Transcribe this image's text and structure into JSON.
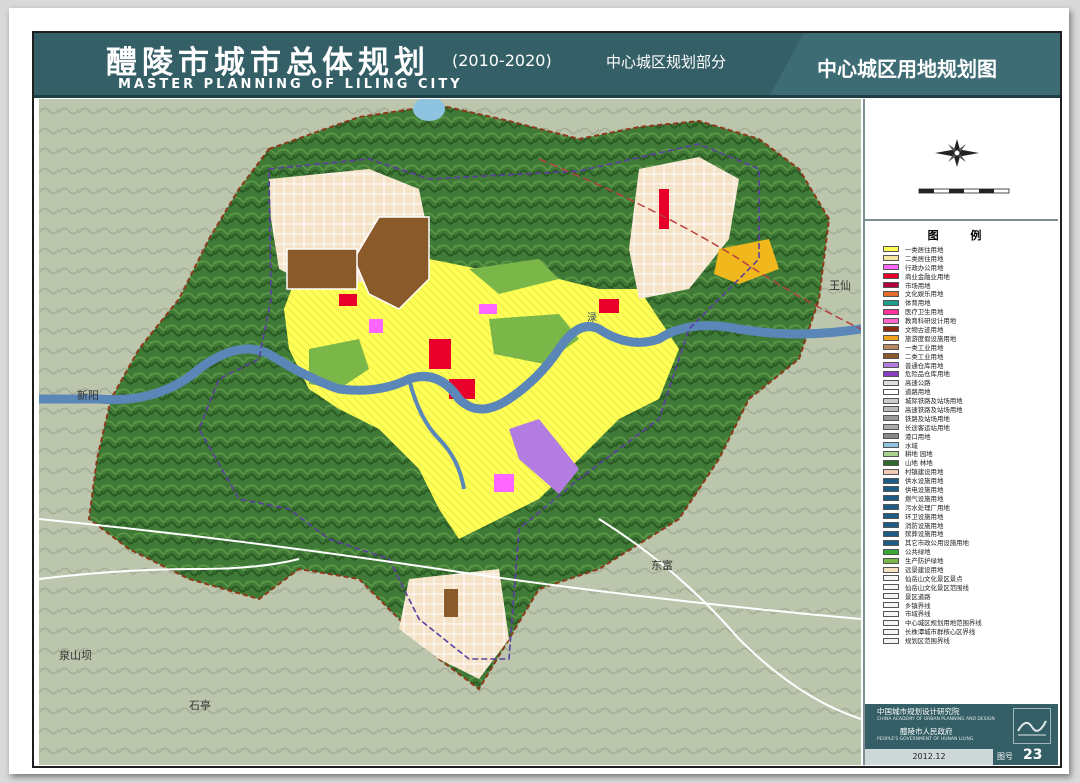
{
  "header": {
    "title_cn": "醴陵市城市总体规划",
    "years": "(2010-2020)",
    "part": "中心城区规划部分",
    "title_en": "MASTER PLANNING OF LILING CITY",
    "map_title": "中心城区用地规划图"
  },
  "legend": {
    "title": "图 例",
    "items": [
      {
        "label": "一类居住用地",
        "color": "#ffff55"
      },
      {
        "label": "二类居住用地",
        "color": "#f5e79e"
      },
      {
        "label": "行政办公用地",
        "color": "#ff66ff"
      },
      {
        "label": "商业金融业用地",
        "color": "#e8002a"
      },
      {
        "label": "市场用地",
        "color": "#b4003a"
      },
      {
        "label": "文化娱乐用地",
        "color": "#e56b2c"
      },
      {
        "label": "体育用地",
        "color": "#1f9e8e"
      },
      {
        "label": "医疗卫生用地",
        "color": "#ff3399"
      },
      {
        "label": "教育科研设计用地",
        "color": "#ff66cc"
      },
      {
        "label": "文物古迹用地",
        "color": "#8b2a0e"
      },
      {
        "label": "旅游度假设施用地",
        "color": "#f0a21c"
      },
      {
        "label": "一类工业用地",
        "color": "#b88a5f"
      },
      {
        "label": "二类工业用地",
        "color": "#8b5a2b"
      },
      {
        "label": "普通仓库用地",
        "color": "#b27ce0"
      },
      {
        "label": "危险品仓库用地",
        "color": "#8a3fc2"
      },
      {
        "label": "高速公路",
        "color": "#dddddd"
      },
      {
        "label": "道路用地",
        "color": "#ffffff"
      },
      {
        "label": "城际铁路及站场用地",
        "color": "#cccccc"
      },
      {
        "label": "高速铁路及站场用地",
        "color": "#bbbbbb"
      },
      {
        "label": "铁路及站场用地",
        "color": "#999999"
      },
      {
        "label": "长途客运站用地",
        "color": "#aaaaaa"
      },
      {
        "label": "港口用地",
        "color": "#888888"
      },
      {
        "label": "水域",
        "color": "#8ec4e0"
      },
      {
        "label": "耕地 园地",
        "color": "#a9d18e"
      },
      {
        "label": "山地 林地",
        "color": "#2e6b2b"
      },
      {
        "label": "村镇建设用地",
        "color": "#f2c9b5"
      },
      {
        "label": "供水设施用地",
        "color": "#1c5c85"
      },
      {
        "label": "供电设施用地",
        "color": "#1c5c85"
      },
      {
        "label": "燃气设施用地",
        "color": "#1c5c85"
      },
      {
        "label": "污水处理厂用地",
        "color": "#1c5c85"
      },
      {
        "label": "环卫设施用地",
        "color": "#1c5c85"
      },
      {
        "label": "消防设施用地",
        "color": "#1c5c85"
      },
      {
        "label": "殡葬设施用地",
        "color": "#1c5c85"
      },
      {
        "label": "其它市政公用设施用地",
        "color": "#1c5c85"
      },
      {
        "label": "公共绿地",
        "color": "#39a935"
      },
      {
        "label": "生产防护绿地",
        "color": "#7ab648"
      },
      {
        "label": "远景建设用地",
        "color": "#f7e2c6"
      },
      {
        "label": "仙岳山文化景区景点",
        "color": "#f5f5f5"
      },
      {
        "label": "仙岳山文化景区范围线",
        "color": "#f5f5f5"
      },
      {
        "label": "景区道路",
        "color": "#f5f5f5"
      },
      {
        "label": "乡镇界线",
        "color": "#f5f5f5"
      },
      {
        "label": "市域界线",
        "color": "#f5f5f5"
      },
      {
        "label": "中心城区规划用地范围界线",
        "color": "#f5f5f5"
      },
      {
        "label": "长株潭城市群核心区界线",
        "color": "#f5f5f5"
      },
      {
        "label": "规划区范围界线",
        "color": "#f5f5f5"
      }
    ]
  },
  "credits": {
    "institute_cn": "中国城市规划设计研究院",
    "institute_en": "CHINA ACADEMY OF URBAN PLANNING AND DESIGN",
    "gov_cn": "醴陵市人民政府",
    "gov_en": "PEOPLE'S GOVERNMENT OF HUNAN LILING",
    "date": "2012.12",
    "map_no_label": "图号",
    "map_no": "23"
  },
  "map_labels": {
    "town_west": "新阳",
    "town_east": "王仙",
    "town_south": "东富",
    "town_sw": "泉山坝",
    "town_s2": "石亭",
    "river": "渌"
  },
  "colors": {
    "header_bg": "#355f66",
    "residential": "#ffff55",
    "forest": "#2e6b2b",
    "river": "#5b86b8",
    "boundary": "#8b3a1a"
  }
}
